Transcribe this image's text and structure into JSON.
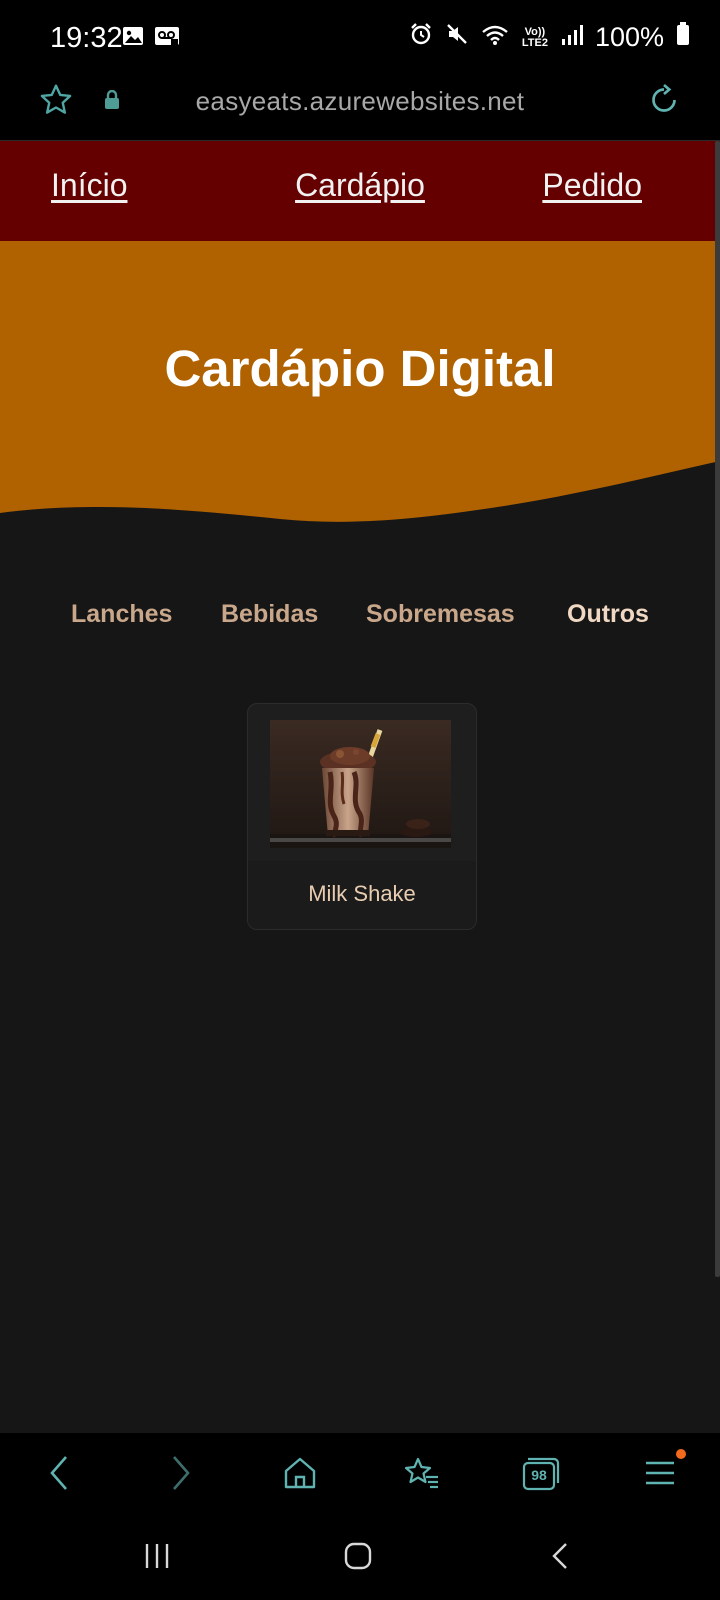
{
  "status_bar": {
    "time": "19:32",
    "network_label": "Vo)) LTE2",
    "battery": "100%",
    "icons": [
      "gallery-icon",
      "voicemail-icon",
      "alarm-icon",
      "mute-icon",
      "wifi-icon",
      "signal-icon",
      "battery-icon"
    ]
  },
  "browser": {
    "url": "easyeats.azurewebsites.net",
    "icons": [
      "star-icon",
      "lock-icon",
      "reload-icon"
    ]
  },
  "nav": {
    "links": [
      "Início",
      "Cardápio",
      "Pedido"
    ]
  },
  "hero": {
    "title": "Cardápio Digital"
  },
  "categories": [
    "Lanches",
    "Bebidas",
    "Sobremesas",
    "Outros"
  ],
  "active_category": "Outros",
  "items": [
    {
      "name": "Milk Shake",
      "image": "milkshake-photo"
    }
  ],
  "toolbar": {
    "tabs_count": "98",
    "icons": [
      "back-icon",
      "forward-icon",
      "home-icon",
      "bookmarks-icon",
      "tabs-icon",
      "menu-icon"
    ]
  },
  "system_nav": {
    "icons": [
      "recents-icon",
      "home-circle-icon",
      "back-arrow-icon"
    ]
  },
  "colors": {
    "nav_bg": "#640000",
    "hero_bg": "#b06100",
    "page_bg": "#161616",
    "category_text": "#c9a78b",
    "accent_teal": "#5fb3b0"
  }
}
